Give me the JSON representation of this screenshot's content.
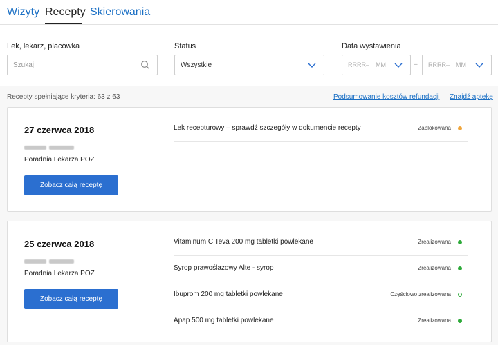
{
  "tabs": [
    {
      "label": "Wizyty"
    },
    {
      "label": "Recepty"
    },
    {
      "label": "Skierowania"
    }
  ],
  "filters": {
    "search_label": "Lek, lekarz, placówka",
    "search_placeholder": "Szukaj",
    "status_label": "Status",
    "status_value": "Wszystkie",
    "date_label": "Data wystawienia",
    "date_year": "RRRR",
    "date_month": "MM",
    "date_separator": "–"
  },
  "summary": {
    "criteria_text": "Recepty spełniające kryteria: 63 z 63",
    "refund_link": "Podsumowanie kosztów refundacji",
    "pharmacy_link": "Znajdź aptekę"
  },
  "cards": [
    {
      "date": "27 czerwca 2018",
      "clinic": "Poradnia Lekarza POZ",
      "button": "Zobacz całą receptę",
      "items": [
        {
          "name": "Lek recepturowy – sprawdź szczegóły w dokumencie recepty",
          "status": "Zablokowana",
          "state": "locked"
        }
      ]
    },
    {
      "date": "25 czerwca 2018",
      "clinic": "Poradnia Lekarza POZ",
      "button": "Zobacz całą receptę",
      "items": [
        {
          "name": "Vitaminum C Teva 200 mg tabletki powlekane",
          "status": "Zrealizowana",
          "state": "done"
        },
        {
          "name": "Syrop prawoślazowy Alte - syrop",
          "status": "Zrealizowana",
          "state": "done"
        },
        {
          "name": "Ibuprom 200 mg tabletki powlekane",
          "status": "Częściowo zrealizowana",
          "state": "partial"
        },
        {
          "name": "Apap 500 mg tabletki powlekane",
          "status": "Zrealizowana",
          "state": "done"
        }
      ]
    }
  ],
  "colors": {
    "link": "#1a6fc4",
    "button": "#2b6fd0",
    "status_done": "#2eaa3a",
    "status_locked": "#f0a63c"
  }
}
